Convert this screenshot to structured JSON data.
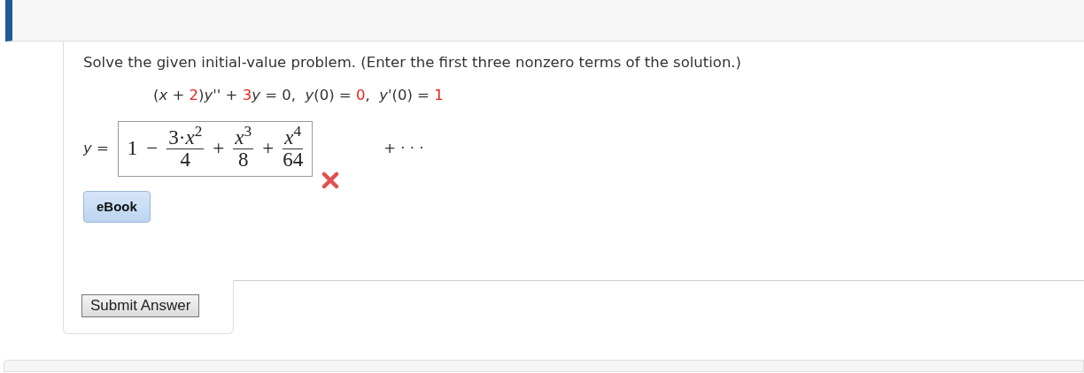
{
  "instruction": "Solve the given initial-value problem. (Enter the first three nonzero terms of the solution.)",
  "equation": [
    {
      "kind": "plain",
      "text": "("
    },
    {
      "kind": "var",
      "text": "x"
    },
    {
      "kind": "plain",
      "text": " + "
    },
    {
      "kind": "given",
      "text": "2"
    },
    {
      "kind": "plain",
      "text": ")"
    },
    {
      "kind": "var",
      "text": "y''"
    },
    {
      "kind": "plain",
      "text": " + "
    },
    {
      "kind": "given",
      "text": "3"
    },
    {
      "kind": "var",
      "text": "y"
    },
    {
      "kind": "plain",
      "text": " = 0,  "
    },
    {
      "kind": "var",
      "text": "y"
    },
    {
      "kind": "plain",
      "text": "(0) = "
    },
    {
      "kind": "given",
      "text": "0"
    },
    {
      "kind": "plain",
      "text": ",  "
    },
    {
      "kind": "var",
      "text": "y'"
    },
    {
      "kind": "plain",
      "text": "(0) = "
    },
    {
      "kind": "given",
      "text": "1"
    }
  ],
  "answer": {
    "label": "y",
    "equals": "=",
    "terms": [
      {
        "kind": "text",
        "text": "1"
      },
      {
        "kind": "op",
        "text": "−"
      },
      {
        "kind": "frac",
        "num": "3·*x*$^{2}$",
        "den": "4"
      },
      {
        "kind": "op",
        "text": "+"
      },
      {
        "kind": "frac",
        "num": "*x*$^{3}$",
        "den": "8"
      },
      {
        "kind": "op",
        "text": "+"
      },
      {
        "kind": "frac",
        "num": "*x*$^{4}$",
        "den": "64"
      }
    ],
    "correct": false,
    "suffix": "+ · · ·"
  },
  "ebook_button": "eBook",
  "submit_button": "Submit Answer"
}
